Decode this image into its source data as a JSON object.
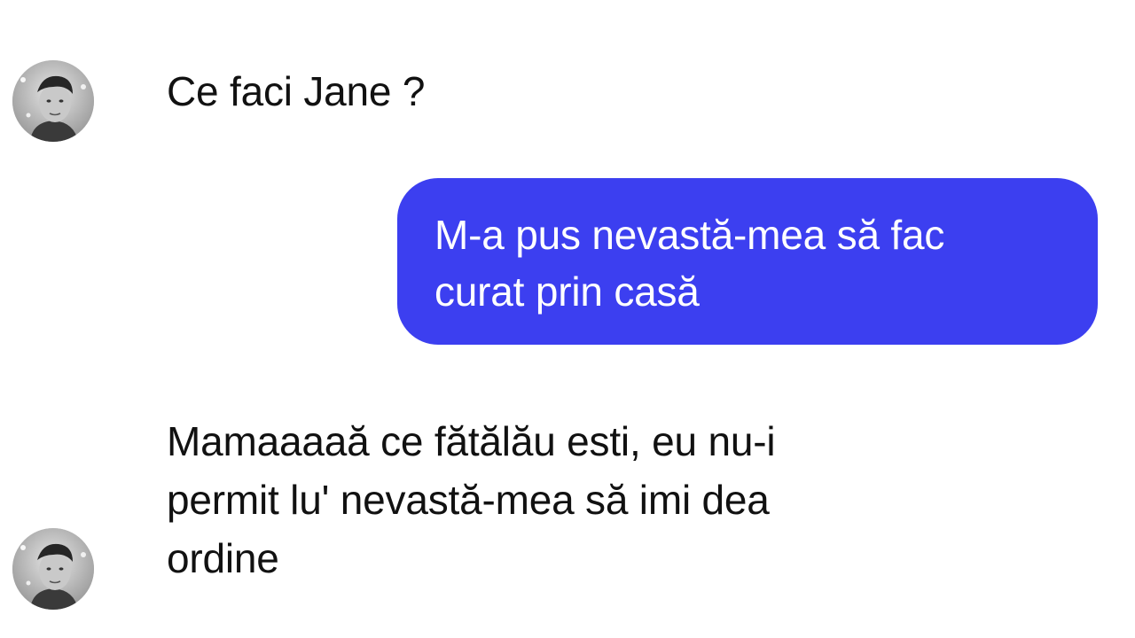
{
  "conversation": {
    "messages": [
      {
        "sender": "other",
        "text": "Ce faci Jane ?",
        "avatar_icon": "profile-photo-icon"
      },
      {
        "sender": "me",
        "text": "M-a pus nevastă-mea să fac\ncurat prin casă",
        "bubble_color": "#3c3ff0",
        "text_color": "#ffffff"
      },
      {
        "sender": "other",
        "text": "Mamaaaaă ce fătălău esti, eu nu-i\npermit lu' nevastă-mea să imi dea\nordine",
        "avatar_icon": "profile-photo-icon"
      }
    ],
    "background_color": "#ffffff"
  }
}
